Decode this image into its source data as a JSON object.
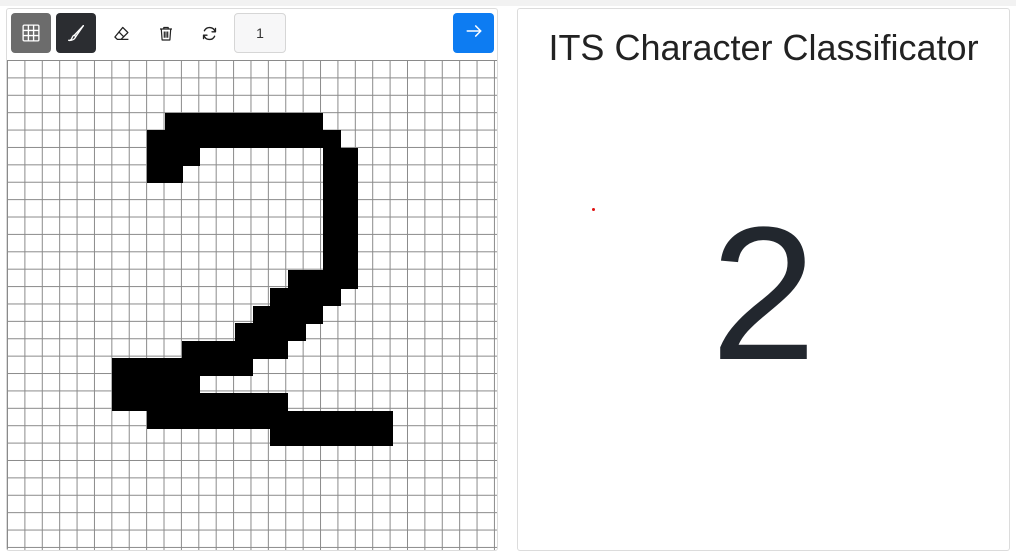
{
  "toolbar": {
    "grid_toggle_icon": "grid-icon",
    "brush_icon": "brush-icon",
    "eraser_icon": "eraser-icon",
    "clear_icon": "trash-icon",
    "reset_icon": "refresh-icon",
    "brush_size_value": "1",
    "submit_icon": "arrow-right-icon",
    "colors": {
      "grid_button_active": "#6c6c6c",
      "brush_button_active": "#2b2d31",
      "submit_button": "#0d7cf2"
    }
  },
  "canvas": {
    "columns": 28,
    "rows": 28,
    "filled_cells": [
      [
        9,
        3
      ],
      [
        10,
        3
      ],
      [
        11,
        3
      ],
      [
        12,
        3
      ],
      [
        13,
        3
      ],
      [
        14,
        3
      ],
      [
        15,
        3
      ],
      [
        16,
        3
      ],
      [
        17,
        3
      ],
      [
        8,
        4
      ],
      [
        9,
        4
      ],
      [
        10,
        4
      ],
      [
        11,
        4
      ],
      [
        12,
        4
      ],
      [
        13,
        4
      ],
      [
        14,
        4
      ],
      [
        15,
        4
      ],
      [
        16,
        4
      ],
      [
        17,
        4
      ],
      [
        18,
        4
      ],
      [
        8,
        5
      ],
      [
        9,
        5
      ],
      [
        10,
        5
      ],
      [
        18,
        5
      ],
      [
        19,
        5
      ],
      [
        8,
        6
      ],
      [
        9,
        6
      ],
      [
        18,
        6
      ],
      [
        19,
        6
      ],
      [
        18,
        7
      ],
      [
        19,
        7
      ],
      [
        18,
        8
      ],
      [
        19,
        8
      ],
      [
        18,
        9
      ],
      [
        19,
        9
      ],
      [
        18,
        10
      ],
      [
        19,
        10
      ],
      [
        18,
        11
      ],
      [
        19,
        11
      ],
      [
        16,
        12
      ],
      [
        17,
        12
      ],
      [
        18,
        12
      ],
      [
        19,
        12
      ],
      [
        15,
        13
      ],
      [
        16,
        13
      ],
      [
        17,
        13
      ],
      [
        18,
        13
      ],
      [
        14,
        14
      ],
      [
        15,
        14
      ],
      [
        16,
        14
      ],
      [
        17,
        14
      ],
      [
        13,
        15
      ],
      [
        14,
        15
      ],
      [
        15,
        15
      ],
      [
        16,
        15
      ],
      [
        10,
        16
      ],
      [
        11,
        16
      ],
      [
        12,
        16
      ],
      [
        13,
        16
      ],
      [
        14,
        16
      ],
      [
        15,
        16
      ],
      [
        6,
        17
      ],
      [
        7,
        17
      ],
      [
        8,
        17
      ],
      [
        9,
        17
      ],
      [
        10,
        17
      ],
      [
        11,
        17
      ],
      [
        12,
        17
      ],
      [
        13,
        17
      ],
      [
        6,
        18
      ],
      [
        7,
        18
      ],
      [
        8,
        18
      ],
      [
        9,
        18
      ],
      [
        10,
        18
      ],
      [
        6,
        19
      ],
      [
        7,
        19
      ],
      [
        8,
        19
      ],
      [
        9,
        19
      ],
      [
        10,
        19
      ],
      [
        11,
        19
      ],
      [
        12,
        19
      ],
      [
        13,
        19
      ],
      [
        14,
        19
      ],
      [
        15,
        19
      ],
      [
        8,
        20
      ],
      [
        9,
        20
      ],
      [
        10,
        20
      ],
      [
        11,
        20
      ],
      [
        12,
        20
      ],
      [
        13,
        20
      ],
      [
        14,
        20
      ],
      [
        15,
        20
      ],
      [
        16,
        20
      ],
      [
        17,
        20
      ],
      [
        18,
        20
      ],
      [
        19,
        20
      ],
      [
        20,
        20
      ],
      [
        21,
        20
      ],
      [
        15,
        21
      ],
      [
        16,
        21
      ],
      [
        17,
        21
      ],
      [
        18,
        21
      ],
      [
        19,
        21
      ],
      [
        20,
        21
      ],
      [
        21,
        21
      ]
    ]
  },
  "result": {
    "title": "ITS Character Classificator",
    "prediction": "2"
  }
}
